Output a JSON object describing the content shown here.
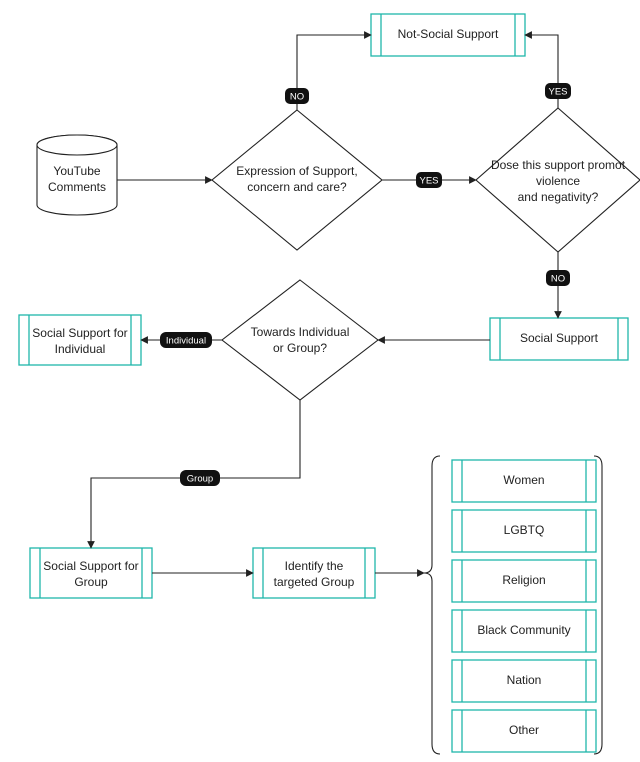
{
  "colors": {
    "teal": "#1fb6ab",
    "pill_bg": "#111111"
  },
  "nodes": {
    "source": {
      "line1": "YouTube",
      "line2": "Comments"
    },
    "decision_expression": {
      "line1": "Expression of Support,",
      "line2": "concern and care?"
    },
    "decision_violence": {
      "line1": "Dose this support promot",
      "line2": "violence",
      "line3": "and negativity?"
    },
    "not_social_support": "Not-Social Support",
    "social_support": "Social Support",
    "decision_target": {
      "line1": "Towards Individual",
      "line2": "or Group?"
    },
    "support_individual": {
      "line1": "Social Support for",
      "line2": "Individual"
    },
    "support_group": {
      "line1": "Social Support for",
      "line2": "Group"
    },
    "identify_group": {
      "line1": "Identify the",
      "line2": "targeted  Group"
    }
  },
  "edge_labels": {
    "no": "NO",
    "yes": "YES",
    "individual": "Individual",
    "group": "Group"
  },
  "groups": [
    "Women",
    "LGBTQ",
    "Religion",
    "Black Community",
    "Nation",
    "Other"
  ]
}
